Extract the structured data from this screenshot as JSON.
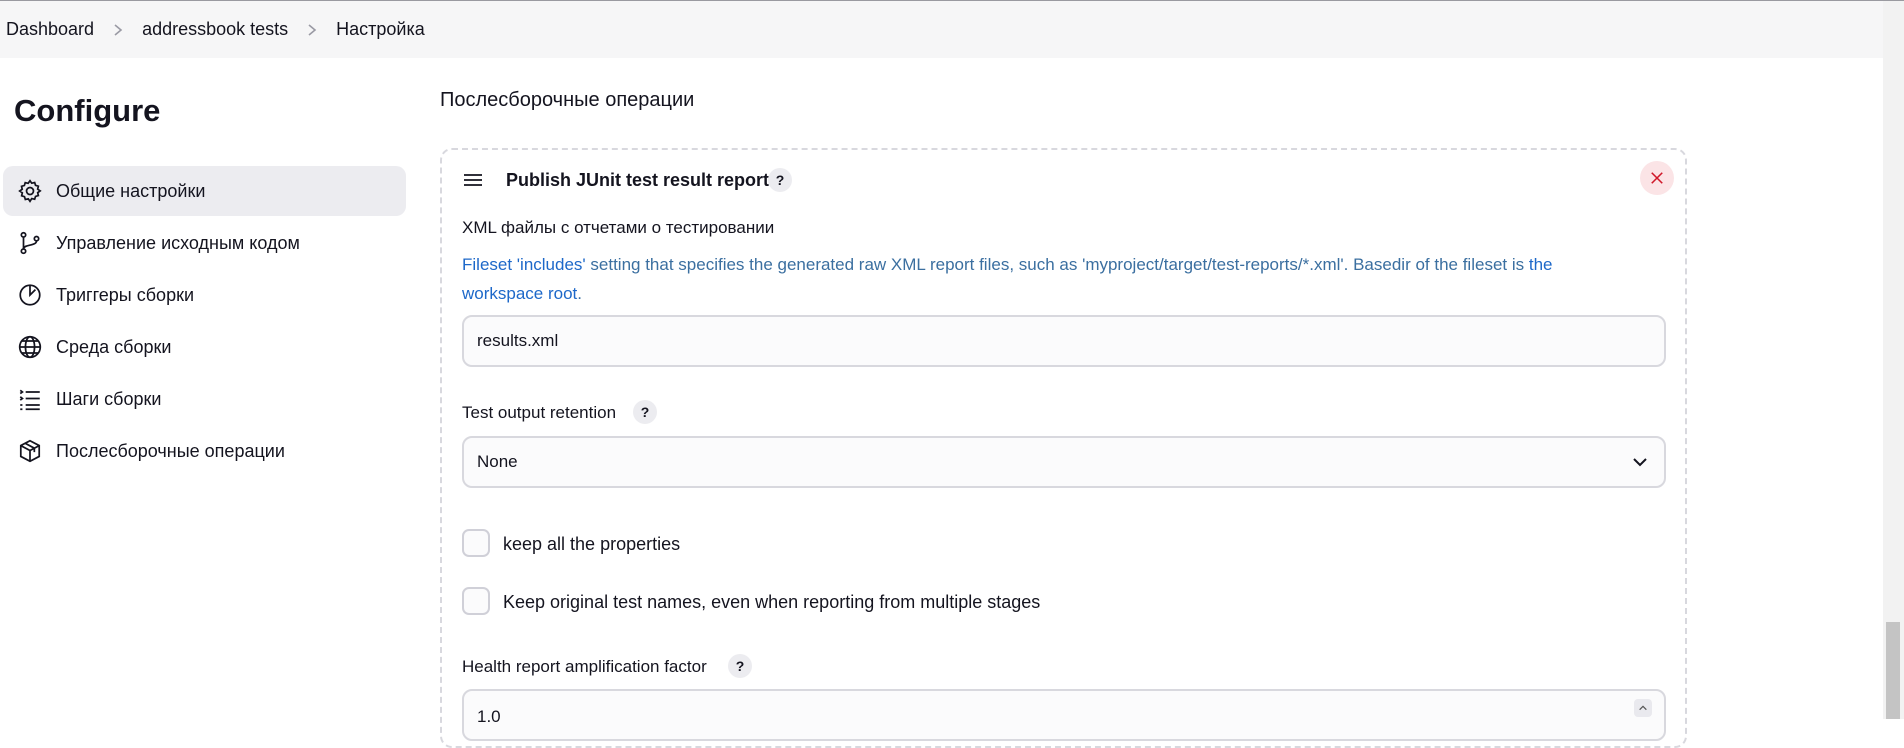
{
  "breadcrumb": {
    "items": [
      "Dashboard",
      "addressbook tests",
      "Настройка"
    ]
  },
  "page": {
    "title": "Configure"
  },
  "sidebar": {
    "items": [
      {
        "label": "Общие настройки",
        "icon": "gear-icon",
        "active": true
      },
      {
        "label": "Управление исходным кодом",
        "icon": "branch-icon",
        "active": false
      },
      {
        "label": "Триггеры сборки",
        "icon": "timer-icon",
        "active": false
      },
      {
        "label": "Среда сборки",
        "icon": "globe-icon",
        "active": false
      },
      {
        "label": "Шаги сборки",
        "icon": "list-icon",
        "active": false
      },
      {
        "label": "Послесборочные операции",
        "icon": "package-icon",
        "active": false
      }
    ]
  },
  "main": {
    "section_title": "Послесборочные операции",
    "card": {
      "title": "Publish JUnit test result report",
      "help": "?",
      "xml_label": "XML файлы с отчетами о тестировании",
      "xml_desc": {
        "link1": "Fileset 'includes'",
        "text1": " setting that specifies the generated raw XML report files, such as 'myproject/target/test-reports/*.xml'. Basedir of the fileset is ",
        "link2": "the workspace root",
        "text2": "."
      },
      "xml_value": "results.xml",
      "retention_label": "Test output retention",
      "retention_value": "None",
      "checkbox1_label": "keep all the properties",
      "checkbox1_checked": false,
      "checkbox2_label": "Keep original test names, even when reporting from multiple stages",
      "checkbox2_checked": false,
      "health_label": "Health report amplification factor",
      "health_value": "1.0"
    }
  },
  "colors": {
    "accent_link": "#1d68c9",
    "close_bg": "#fbe4e6",
    "close_x": "#d0182a",
    "active_bg": "#ececf0"
  }
}
